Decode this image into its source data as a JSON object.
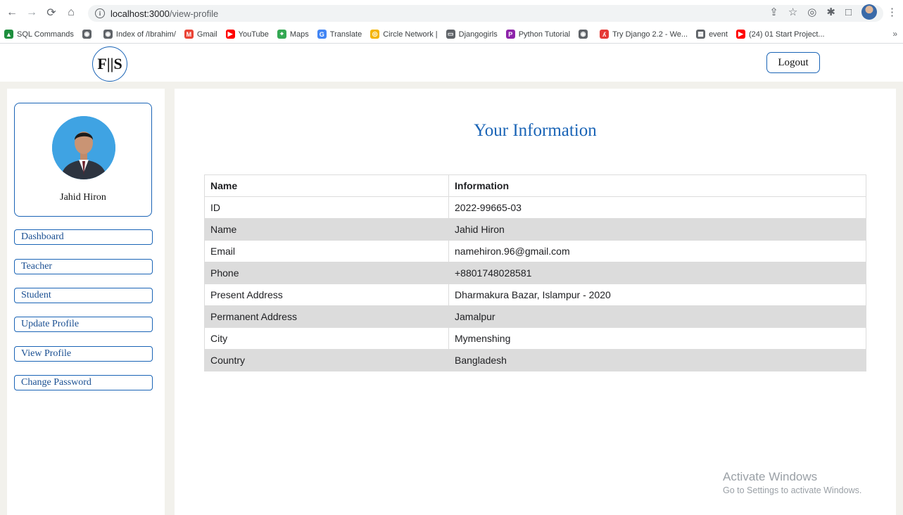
{
  "browser": {
    "url_host": "localhost:3000",
    "url_path": "/view-profile"
  },
  "bookmarks": [
    {
      "label": "SQL Commands",
      "icon": "drive-icon",
      "color": "#1e8e3e"
    },
    {
      "label": "",
      "icon": "globe-icon",
      "color": "#5f6368"
    },
    {
      "label": "Index of /Ibrahim/",
      "icon": "globe-icon",
      "color": "#5f6368"
    },
    {
      "label": "Gmail",
      "icon": "gmail-icon",
      "color": "#ea4335"
    },
    {
      "label": "YouTube",
      "icon": "youtube-icon",
      "color": "#ff0000"
    },
    {
      "label": "Maps",
      "icon": "maps-icon",
      "color": "#34a853"
    },
    {
      "label": "Translate",
      "icon": "translate-icon",
      "color": "#4285f4"
    },
    {
      "label": "Circle Network |",
      "icon": "circle-icon",
      "color": "#f4b400"
    },
    {
      "label": "Djangogirls",
      "icon": "book-icon",
      "color": "#5f6368"
    },
    {
      "label": "Python Tutorial",
      "icon": "python-icon",
      "color": "#8e24aa"
    },
    {
      "label": "",
      "icon": "globe-icon",
      "color": "#5f6368"
    },
    {
      "label": "Try Django 2.2 - We...",
      "icon": "django-icon",
      "color": "#e53935"
    },
    {
      "label": "event",
      "icon": "calendar-icon",
      "color": "#5f6368"
    },
    {
      "label": "(24) 01 Start Project...",
      "icon": "youtube-icon",
      "color": "#ff0000"
    }
  ],
  "bookmarks_more": "»",
  "header": {
    "logo_text": "F||S",
    "logout_label": "Logout"
  },
  "profile": {
    "name": "Jahid Hiron"
  },
  "sidebar": {
    "items": [
      {
        "label": "Dashboard"
      },
      {
        "label": "Teacher"
      },
      {
        "label": "Student"
      },
      {
        "label": "Update Profile"
      },
      {
        "label": "View Profile"
      },
      {
        "label": "Change Password"
      }
    ]
  },
  "main": {
    "title": "Your Information",
    "table": {
      "headers": [
        "Name",
        "Information"
      ],
      "rows": [
        [
          "ID",
          "2022-99665-03"
        ],
        [
          "Name",
          "Jahid Hiron"
        ],
        [
          "Email",
          "namehiron.96@gmail.com"
        ],
        [
          "Phone",
          "+8801748028581"
        ],
        [
          "Present Address",
          "Dharmakura Bazar, Islampur - 2020"
        ],
        [
          "Permanent Address",
          "Jamalpur"
        ],
        [
          "City",
          "Mymenshing"
        ],
        [
          "Country",
          "Bangladesh"
        ]
      ]
    }
  },
  "watermark": {
    "line1": "Activate Windows",
    "line2": "Go to Settings to activate Windows."
  },
  "colors": {
    "accent": "#1a64b6",
    "row_alt": "#dcdcdc",
    "page_bg": "#f2f1ec"
  }
}
